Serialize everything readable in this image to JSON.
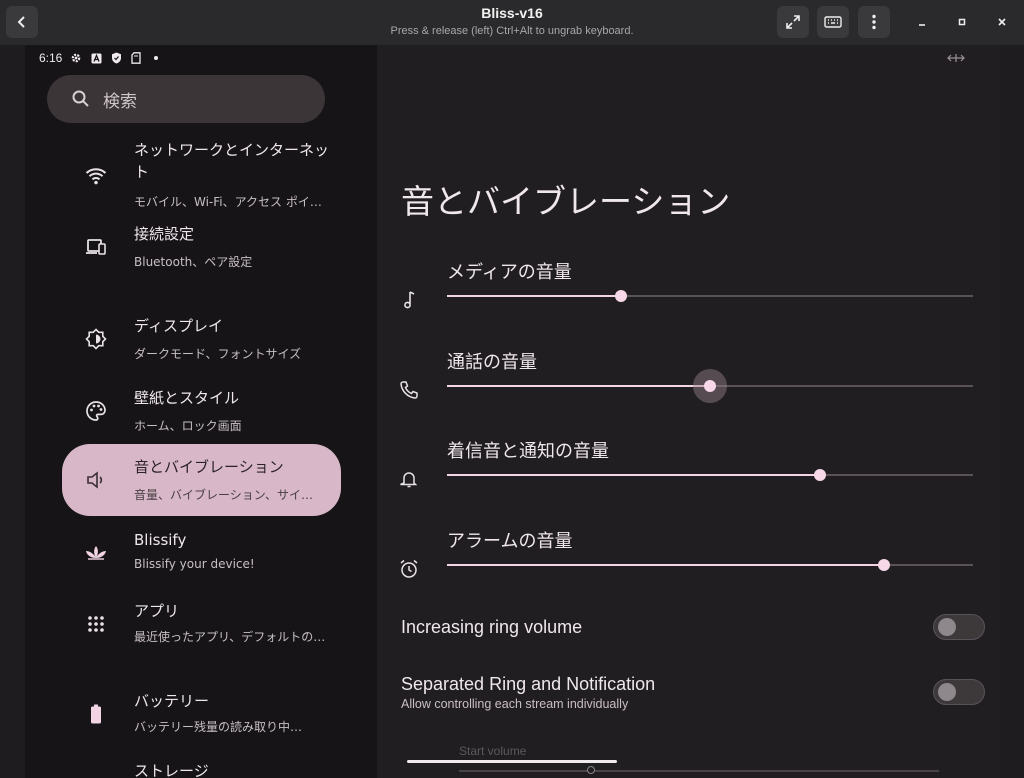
{
  "window": {
    "title": "Bliss-v16",
    "subtitle": "Press & release (left) Ctrl+Alt to ungrab keyboard.",
    "buttons": [
      "back-icon",
      "expand-icon",
      "keyboard-icon",
      "more-vert-icon",
      "minimize-icon",
      "maximize-icon",
      "close-icon"
    ]
  },
  "statusbar": {
    "time": "6:16",
    "icons": [
      "gear-icon",
      "a-icon",
      "shield-icon",
      "sdcard-icon",
      "dot-icon"
    ]
  },
  "search": {
    "placeholder": "検索",
    "icon": "search-icon"
  },
  "nav": {
    "items": [
      {
        "title": "ネットワークとインターネット",
        "subtitle": "モバイル、Wi-Fi、アクセス ポイント",
        "icon": "wifi-icon",
        "active": false
      },
      {
        "title": "接続設定",
        "subtitle": "Bluetooth、ペア設定",
        "icon": "devices-icon",
        "active": false
      },
      {
        "title": "ディスプレイ",
        "subtitle": "ダークモード、フォントサイズ",
        "icon": "brightness-icon",
        "active": false
      },
      {
        "title": "壁紙とスタイル",
        "subtitle": "ホーム、ロック画面",
        "icon": "palette-icon",
        "active": false
      },
      {
        "title": "音とバイブレーション",
        "subtitle": "音量、バイブレーション、サイレント",
        "icon": "volume-icon",
        "active": true
      },
      {
        "title": "Blissify",
        "subtitle": "Blissify your device!",
        "icon": "lotus-icon",
        "active": false
      },
      {
        "title": "アプリ",
        "subtitle": "最近使ったアプリ、デフォルトのアプリ",
        "icon": "apps-grid-icon",
        "active": false
      },
      {
        "title": "バッテリー",
        "subtitle": "バッテリー残量の読み取り中…",
        "icon": "battery-icon",
        "active": false
      },
      {
        "title": "ストレージ",
        "subtitle": "",
        "icon": "storage-icon",
        "active": false
      }
    ]
  },
  "main": {
    "title": "音とバイブレーション",
    "volumes": [
      {
        "label": "メディアの音量",
        "icon": "music-note-icon",
        "level": 0.33
      },
      {
        "label": "通話の音量",
        "icon": "phone-icon",
        "level": 0.5
      },
      {
        "label": "着信音と通知の音量",
        "icon": "bell-icon",
        "level": 0.71
      },
      {
        "label": "アラームの音量",
        "icon": "alarm-icon",
        "level": 0.83
      }
    ],
    "switches": [
      {
        "title": "Increasing ring volume",
        "subtitle": "",
        "on": false
      },
      {
        "title": "Separated Ring and Notification",
        "subtitle": "Allow controlling each stream individually",
        "on": false
      }
    ],
    "start_volume_label": "Start volume"
  },
  "colors": {
    "accent": "#f2d4e4",
    "active_nav": "#d8b8c8",
    "panel": "#211e21",
    "background": "#161416"
  }
}
